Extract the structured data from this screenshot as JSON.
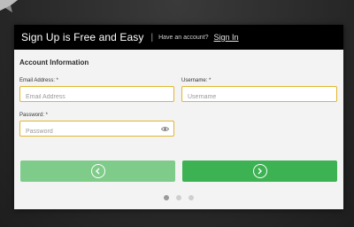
{
  "header": {
    "title": "Sign Up is Free and Easy",
    "separator": "|",
    "question": "Have an account?",
    "signin_link": "Sign In"
  },
  "form": {
    "section_title": "Account Information",
    "email": {
      "label": "Email Address: *",
      "placeholder": "Email Address",
      "value": ""
    },
    "username": {
      "label": "Username: *",
      "placeholder": "Username",
      "value": ""
    },
    "password": {
      "label": "Password: *",
      "placeholder": "Password",
      "value": ""
    }
  },
  "buttons": {
    "prev_icon": "chevron-left-icon",
    "next_icon": "chevron-right-icon"
  },
  "pagination": {
    "total": 3,
    "active_index": 0
  },
  "colors": {
    "header_bg": "#000000",
    "field_border": "#e1b62e",
    "prev_button": "#7fcb8a",
    "next_button": "#3db252",
    "page_bg": "#2b2b2b"
  }
}
